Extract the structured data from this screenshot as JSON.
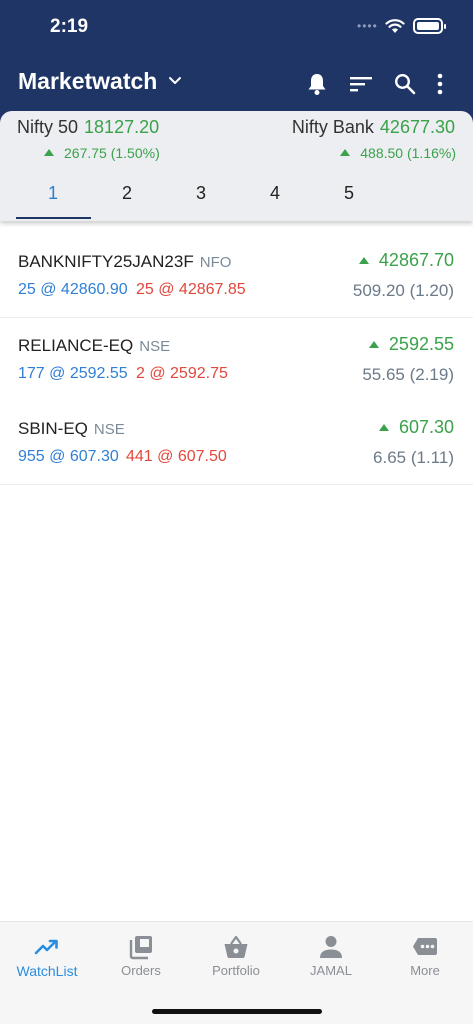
{
  "status_bar": {
    "time": "2:19",
    "dots": "••••"
  },
  "header": {
    "title": "Marketwatch"
  },
  "indices": [
    {
      "name": "Nifty 50",
      "value": "18127.20",
      "change": "267.75 (1.50%)"
    },
    {
      "name": "Nifty Bank",
      "value": "42677.30",
      "change": "488.50 (1.16%)"
    }
  ],
  "tabs": [
    {
      "label": "1",
      "active": true
    },
    {
      "label": "2"
    },
    {
      "label": "3"
    },
    {
      "label": "4"
    },
    {
      "label": "5"
    }
  ],
  "watchlist": [
    {
      "symbol": "BANKNIFTY25JAN23F",
      "exchange": "NFO",
      "bid": "25 @ 42860.90",
      "ask": "25 @ 42867.85",
      "ltp": "42867.70",
      "change": "509.20 (1.20)"
    },
    {
      "symbol": "RELIANCE-EQ",
      "exchange": "NSE",
      "bid": "177 @ 2592.55",
      "ask": "2 @ 2592.75",
      "ltp": "2592.55",
      "change": "55.65 (2.19)"
    },
    {
      "symbol": "SBIN-EQ",
      "exchange": "NSE",
      "bid": "955 @ 607.30",
      "ask": "441 @ 607.50",
      "ltp": "607.30",
      "change": "6.65 (1.11)"
    }
  ],
  "bottom_nav": [
    {
      "label": "WatchList",
      "icon": "trending-up-icon",
      "active": true
    },
    {
      "label": "Orders",
      "icon": "orders-icon"
    },
    {
      "label": "Portfolio",
      "icon": "basket-icon"
    },
    {
      "label": "JAMAL",
      "icon": "person-icon"
    },
    {
      "label": "More",
      "icon": "more-icon"
    }
  ],
  "colors": {
    "header": "#1f3566",
    "up": "#3aa24a",
    "bid": "#2f7fd6",
    "ask": "#e2483c",
    "active_nav": "#2a8ee0"
  }
}
